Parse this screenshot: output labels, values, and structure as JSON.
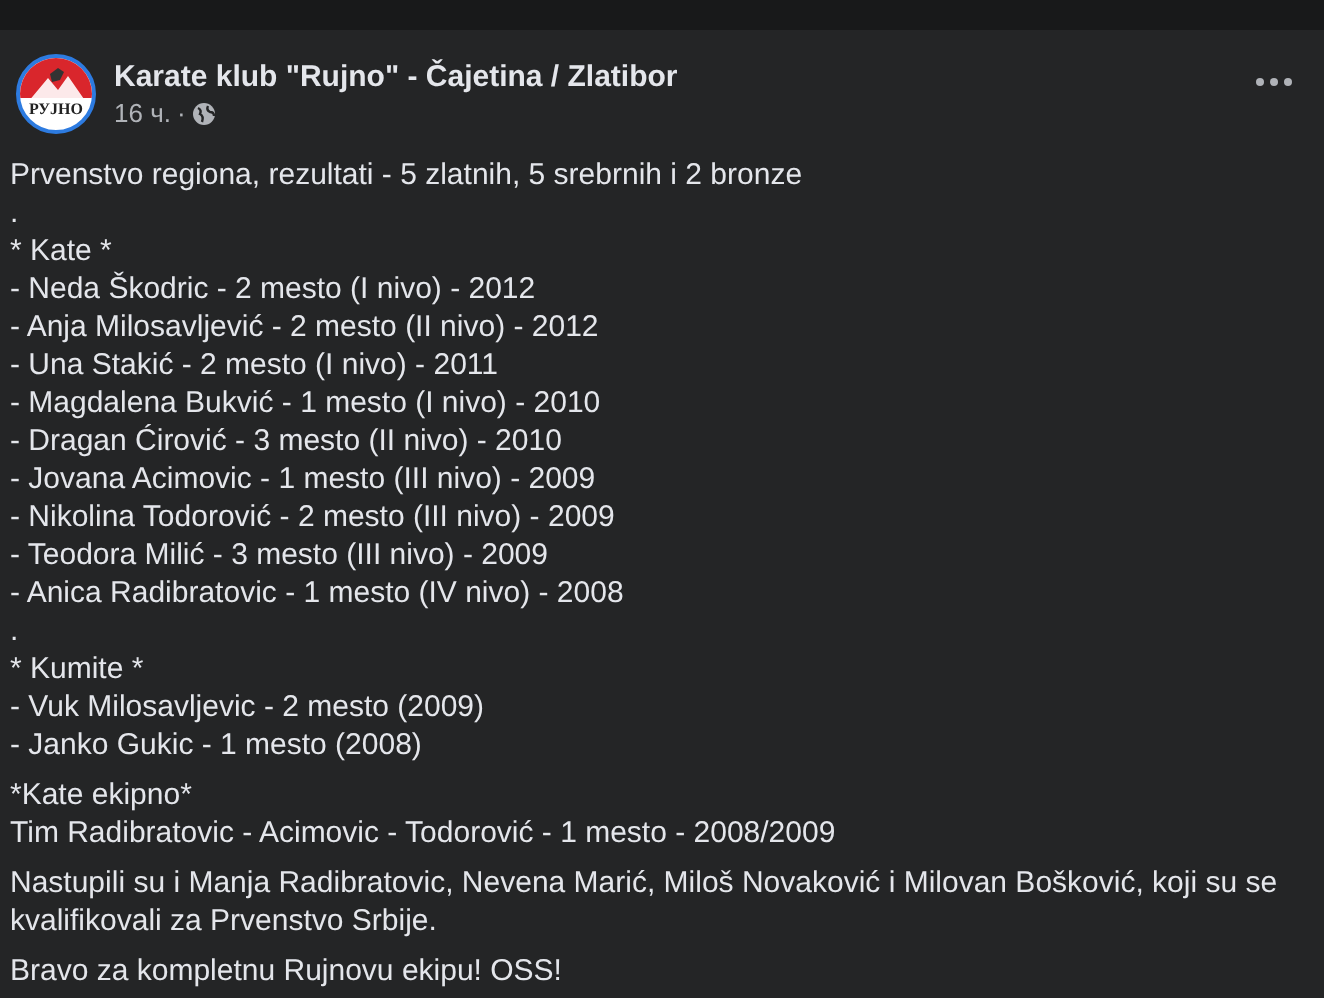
{
  "post": {
    "author": "Karate klub \"Rujno\" - Čajetina / Zlatibor",
    "logo_text": "РУЈНО",
    "time": "16 ч.",
    "separator": "·",
    "paragraphs": [
      {
        "lines": [
          "Prvenstvo regiona, rezultati - 5 zlatnih, 5 srebrnih i 2 bronze",
          ".",
          "* Kate *",
          "- Neda Škodric - 2 mesto (I nivo) - 2012",
          "- Anja Milosavljević - 2 mesto (II nivo) - 2012",
          "- Una Stakić - 2 mesto (I nivo) - 2011",
          "- Magdalena Bukvić - 1 mesto (I nivo) - 2010",
          "- Dragan Ćirović - 3 mesto (II nivo) - 2010",
          "- Jovana Acimovic - 1 mesto (III nivo) - 2009",
          "- Nikolina Todorović - 2 mesto (III nivo) - 2009",
          "- Teodora Milić - 3 mesto (III nivo) - 2009",
          "- Anica Radibratovic - 1 mesto (IV nivo) - 2008",
          ".",
          "* Kumite *",
          "- Vuk Milosavljevic - 2 mesto (2009)",
          "- Janko Gukic - 1 mesto (2008)"
        ]
      },
      {
        "lines": [
          "*Kate ekipno*",
          "Tim Radibratovic - Acimovic - Todorović - 1 mesto - 2008/2009"
        ]
      },
      {
        "lines": [
          "Nastupili su i Manja Radibratovic, Nevena Marić, Miloš Novaković i Milovan Bošković, koji su se kvalifikovali za Prvenstvo Srbije."
        ]
      },
      {
        "lines": [
          "Bravo za kompletnu Rujnovu ekipu! OSS!"
        ]
      }
    ]
  }
}
